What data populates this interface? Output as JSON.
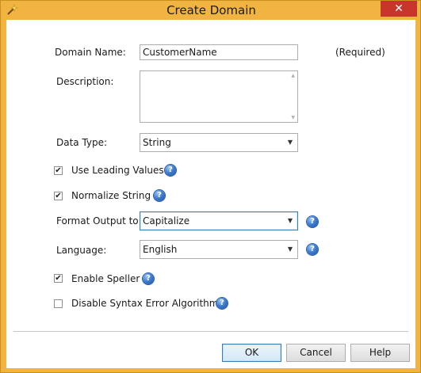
{
  "window": {
    "title": "Create Domain",
    "close_label": "✕"
  },
  "form": {
    "domain_name_label": "Domain Name:",
    "domain_name_value": "CustomerName",
    "required_label": "(Required)",
    "description_label": "Description:",
    "description_value": "",
    "data_type_label": "Data Type:",
    "data_type_value": "String",
    "use_leading_values_label": "Use Leading Values",
    "use_leading_values_checked": true,
    "normalize_string_label": "Normalize String",
    "normalize_string_checked": true,
    "format_output_label": "Format Output to:",
    "format_output_value": "Capitalize",
    "language_label": "Language:",
    "language_value": "English",
    "enable_speller_label": "Enable Speller",
    "enable_speller_checked": true,
    "disable_syntax_label": "Disable Syntax Error Algorithms",
    "disable_syntax_checked": false
  },
  "buttons": {
    "ok": "OK",
    "cancel": "Cancel",
    "help": "Help"
  },
  "icons": {
    "app": "wand-icon",
    "help": "help-icon",
    "dropdown": "chevron-down-icon",
    "check": "checkmark-icon"
  }
}
